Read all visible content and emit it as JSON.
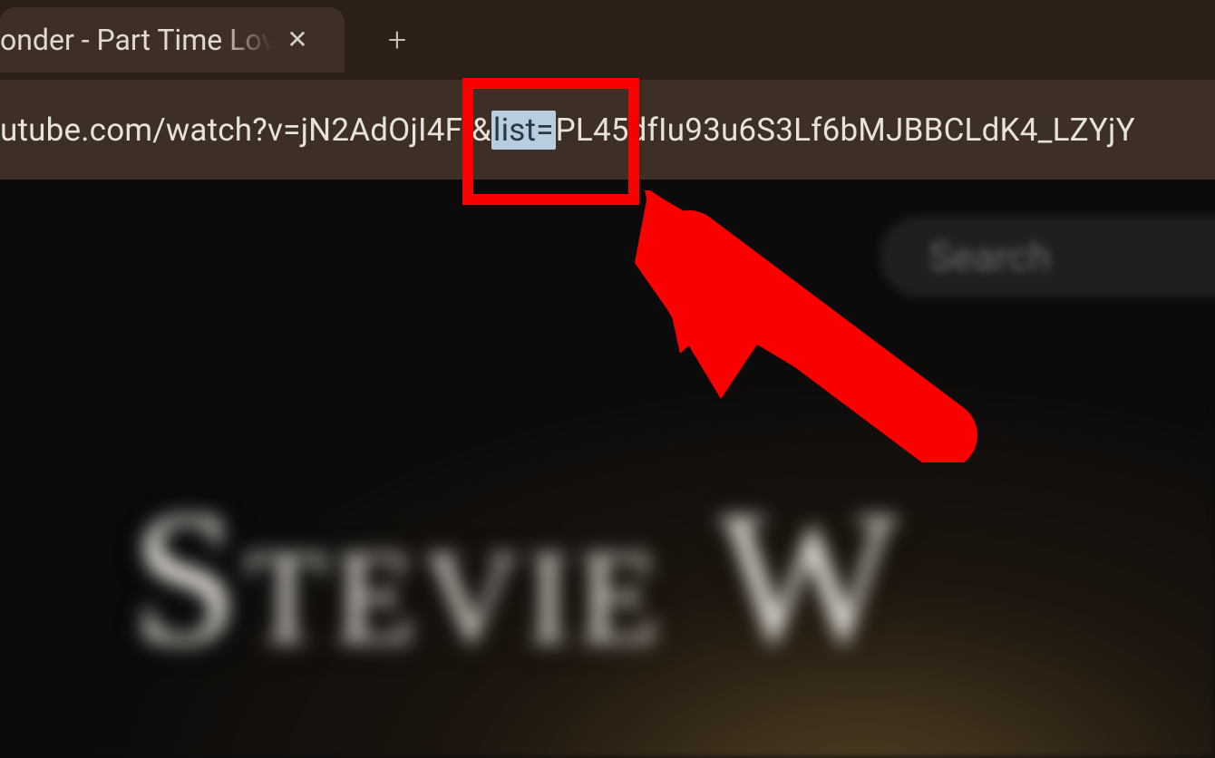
{
  "tab": {
    "title": "onder - Part Time Lov",
    "close_glyph": "✕",
    "new_tab_glyph": "+"
  },
  "address_bar": {
    "url_pre": "utube.com/watch?v=jN2AdOjI4FI&",
    "url_selected": "list=",
    "url_post": "PL45dfIu93u6S3Lf6bMJBBCLdK4_LZYjY"
  },
  "page": {
    "search_placeholder": "Search",
    "video_title_text": "Stevie W"
  },
  "annotation": {
    "box_color": "#fb0000",
    "arrow_color": "#fb0000"
  }
}
